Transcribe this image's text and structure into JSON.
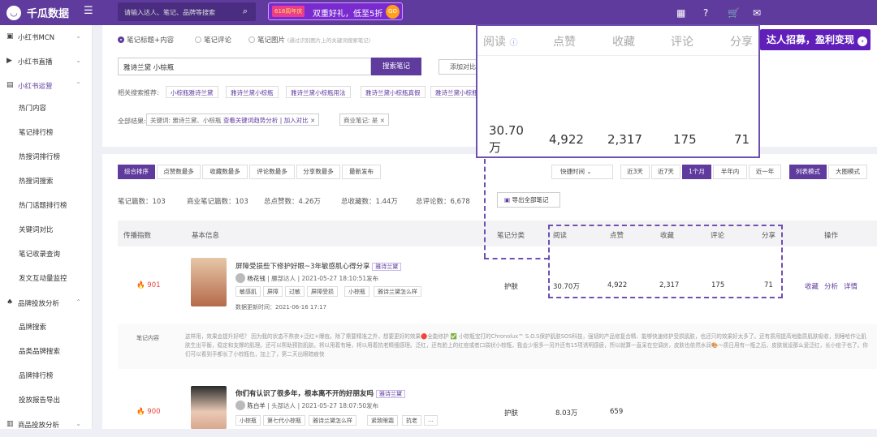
{
  "topbar": {
    "logo": "千瓜数据",
    "search_placeholder": "请输入达人、笔记、品牌等搜索",
    "promo_tag": "618周年庆",
    "promo_text": "双重好礼，低至5折",
    "promo_go": "GO"
  },
  "sidebar": {
    "items": [
      {
        "label": "小红书MCN",
        "icon": "mcn-icon"
      },
      {
        "label": "小红书直播",
        "icon": "live-icon"
      },
      {
        "label": "小红书运营",
        "icon": "operation-icon"
      }
    ],
    "sub_items": [
      "热门内容",
      "笔记排行榜",
      "热搜词排行榜",
      "热搜词搜索",
      "热门话题排行榜",
      "关键词对比",
      "笔记收录查询",
      "发文互动量监控"
    ],
    "items2": [
      {
        "label": "品牌投放分析",
        "icon": "brand-icon"
      }
    ],
    "sub_items2": [
      "品牌搜索",
      "品类品牌搜索",
      "品牌排行榜",
      "投放报告导出"
    ],
    "items3": [
      {
        "label": "商品投放分析",
        "icon": "product-icon"
      }
    ]
  },
  "search": {
    "radios": [
      "笔记标题+内容",
      "笔记评论",
      "笔记图片"
    ],
    "radio_hint": "(通过识别图片上的关键词搜索笔记)",
    "keyword": "雅诗兰黛 小棕瓶",
    "search_btn": "搜索笔记",
    "add_btn": "添加对比",
    "related_label": "相关搜索推荐:",
    "related": [
      "小棕瓶雅诗兰黛",
      "雅诗兰黛小棕瓶",
      "雅诗兰黛小棕瓶用法",
      "雅诗兰黛小棕瓶真假",
      "雅诗兰黛小棕瓶"
    ],
    "result_label": "全部结果:",
    "chip1": "关键词: 雅诗兰黛、小棕瓶",
    "chip1_link": "查看关键词趋势分析 | 加入对比",
    "chip2": "商业笔记: 是"
  },
  "highlight": {
    "headers": [
      "阅读",
      "点赞",
      "收藏",
      "评论",
      "分享"
    ],
    "values": [
      "30.70\n万",
      "4,922",
      "2,317",
      "175",
      "71"
    ]
  },
  "recruit": "达人招募，盈利变现",
  "tabs": [
    "综合排序",
    "点赞数最多",
    "收藏数最多",
    "评论数最多",
    "分享数最多",
    "最新发布"
  ],
  "time_select": "快捷时间",
  "time_tabs": [
    "近3天",
    "近7天",
    "1个月",
    "半年内",
    "近一年"
  ],
  "view_tabs": [
    "列表模式",
    "大图模式"
  ],
  "stats": [
    "笔记篇数：103",
    "商业笔记篇数：103",
    "总点赞数：4.26万",
    "总收藏数：1.44万",
    "总评论数：6,678"
  ],
  "export_btn": "导出全部笔记",
  "table": {
    "headers": [
      "传播指数",
      "基本信息",
      "笔记分类",
      "阅读",
      "点赞",
      "收藏",
      "评论",
      "分享",
      "操作"
    ],
    "rows": [
      {
        "score": "901",
        "title": "屏障受损些下修护好眼~3年敏感肌心得分享",
        "badge": "雅诗兰黛",
        "author": "杨花钱",
        "author_tag": "腰部达人",
        "date": "2021-05-27 18:10:51发布",
        "tags": [
          "敏感肌",
          "屏障",
          "过敏",
          "屏障受损",
          "小棕瓶",
          "雅诗兰黛怎么样"
        ],
        "collected": "数据更新时间：2021-06-16 17:17",
        "category": "护肤",
        "read": "30.70万",
        "like": "4,922",
        "fav": "2,317",
        "comment": "175",
        "share": "71",
        "actions": [
          "收藏",
          "分析",
          "详情"
        ]
      },
      {
        "score": "900",
        "title": "你们有认识了很多年，根本离不开的好朋友吗",
        "badge": "雅诗兰黛",
        "author": "陈白羊",
        "author_tag": "头部达人",
        "date": "2021-05-27 18:07:50发布",
        "tags": [
          "小棕瓶",
          "第七代小棕瓶",
          "雅诗兰黛怎么样",
          "紧致眼霜",
          "抗老",
          "..."
        ],
        "category": "护肤",
        "read": "8.03万",
        "like": "659"
      }
    ],
    "content_label": "笔记内容",
    "content_text": "这样用，效果会提升好吧？ 因为我的状态不熬夜+泛红+爆痘。除了需要精准之外，想要更好的效果🔴全能修护 ✅ 小棕瓶宝打的Chronolux™ S.O.S保护肌肤SOS科技，强韧的产品修复合精、能够快速修护受损肌肤，也还只的效果好太多了。还有质用提高地脂质肌肤吸收，到睡哈作让肌肤生出平衡，稳定和支撑的肌理。还可以帮助预防肌肤。将以用着有睡，将以用着抗老精细感理。泛红，还有脸上的红痘或者口袋状小棕瓶，我会少很多一另外还有15项诱明感疲，所以就算一直呆在空调房，皮肤也依然水润🎨～质日用有一瓶之后，皮肤就设那么爱泛红，长小痘子也了。你们可以看到手都长了小棕瓶包，加上了，第二天出眼暗痕快"
  }
}
